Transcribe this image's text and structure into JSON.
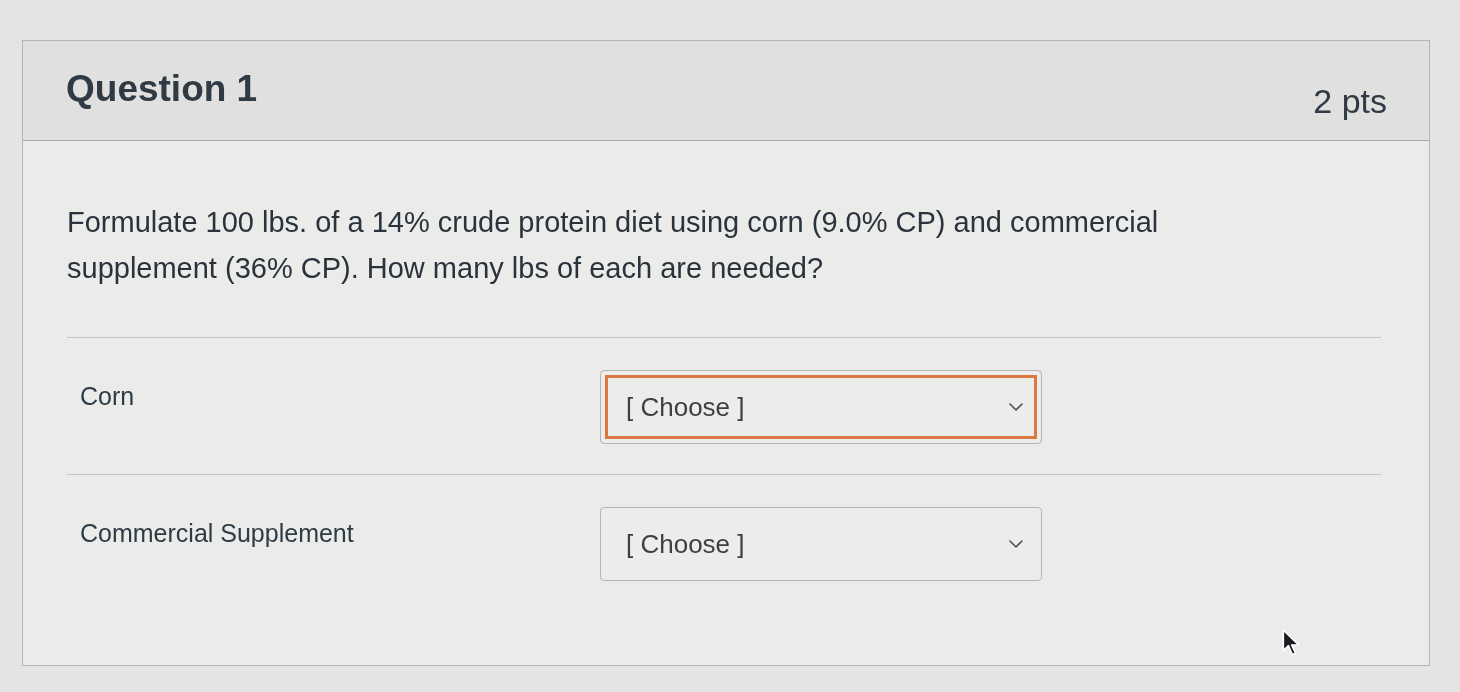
{
  "question": {
    "title": "Question 1",
    "points": "2 pts",
    "text": "Formulate 100 lbs. of a 14% crude protein diet using corn (9.0% CP) and commercial supplement (36% CP). How many lbs of each are needed?",
    "answers": [
      {
        "label": "Corn",
        "placeholder": "[ Choose ]",
        "focused": true
      },
      {
        "label": "Commercial Supplement",
        "placeholder": "[ Choose ]",
        "focused": false
      }
    ]
  }
}
